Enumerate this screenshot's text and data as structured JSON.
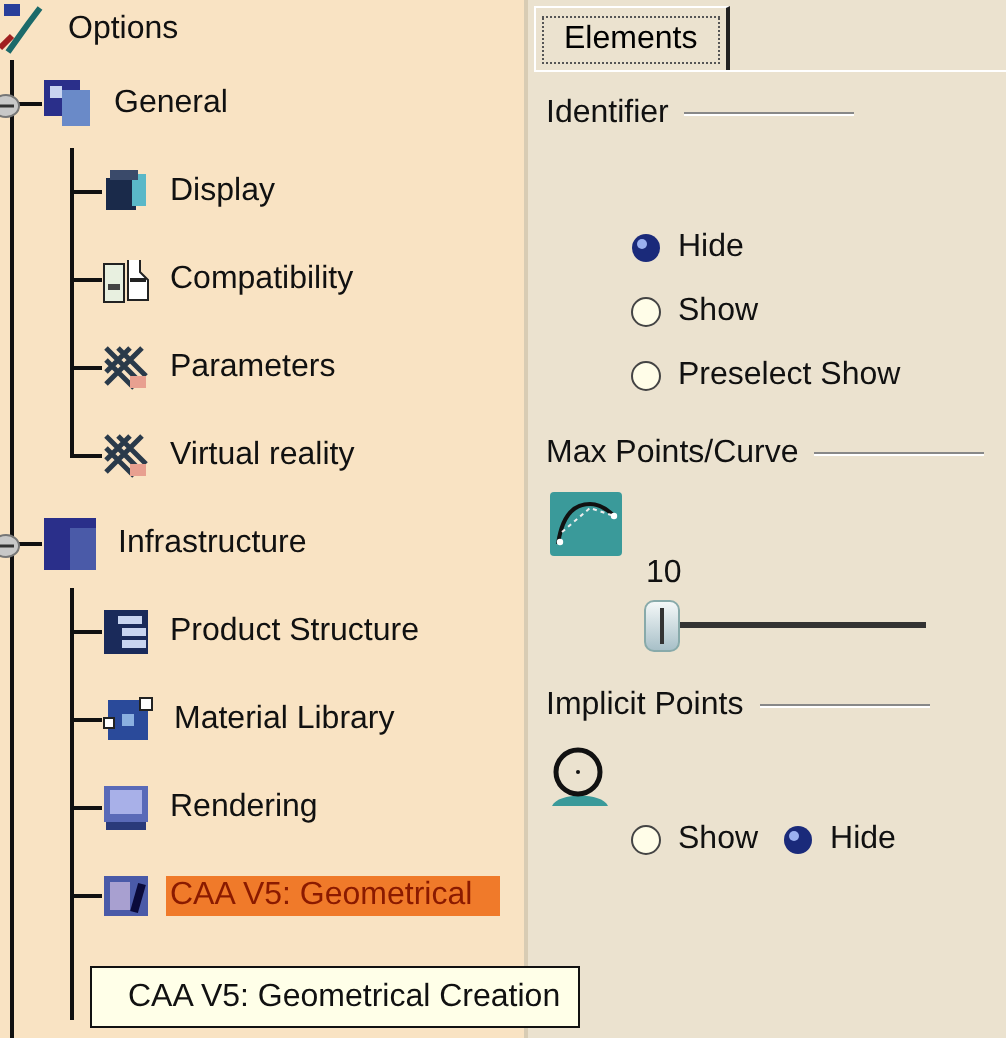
{
  "tree": {
    "label": "Options",
    "selected": false,
    "children": [
      {
        "label": "General",
        "selected": false,
        "expanded": true,
        "children": [
          {
            "label": "Display",
            "selected": false
          },
          {
            "label": "Compatibility",
            "selected": false
          },
          {
            "label": "Parameters",
            "selected": false
          },
          {
            "label": "Virtual reality",
            "selected": false
          }
        ]
      },
      {
        "label": "Infrastructure",
        "selected": false,
        "expanded": true,
        "children": [
          {
            "label": "Product Structure",
            "selected": false
          },
          {
            "label": "Material Library",
            "selected": false
          },
          {
            "label": "Rendering",
            "selected": false
          },
          {
            "label": "CAA V5: Geometrical",
            "selected": true
          }
        ]
      }
    ]
  },
  "tooltip": {
    "text": "CAA V5: Geometrical Creation"
  },
  "tabs": [
    {
      "label": "Elements",
      "selected": true
    }
  ],
  "sections": [
    {
      "kind": "radio-list",
      "title": "Identifier",
      "options": [
        {
          "label": "Hide",
          "selected": true
        },
        {
          "label": "Show",
          "selected": false
        },
        {
          "label": "Preselect Show",
          "selected": false
        }
      ]
    },
    {
      "kind": "slider",
      "title": "Max Points/Curve",
      "reading": "10",
      "level": 0
    },
    {
      "kind": "radio-row",
      "title": "Implicit Points",
      "options": [
        {
          "label": "Show",
          "selected": false
        },
        {
          "label": "Hide",
          "selected": true
        }
      ]
    }
  ]
}
